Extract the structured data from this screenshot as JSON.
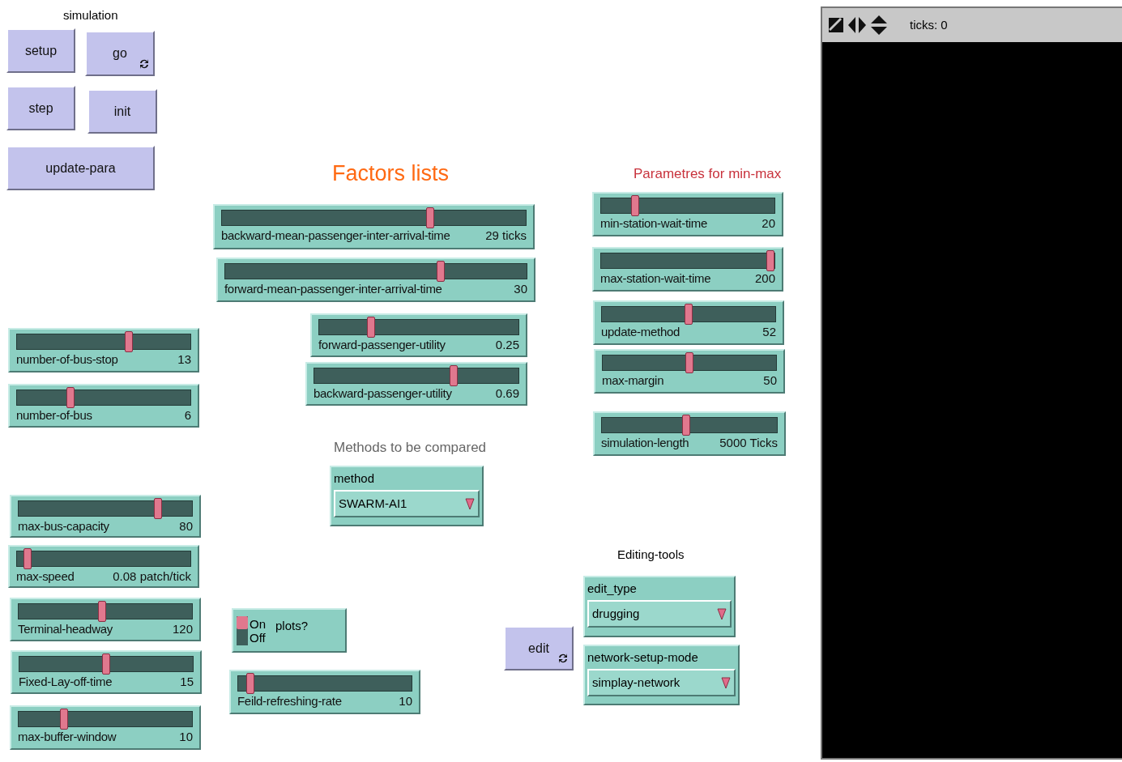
{
  "labels": [
    {
      "text": "simulation",
      "kind": "plain"
    },
    {
      "text": "Factors lists",
      "kind": "title"
    },
    {
      "text": "Parametres for min-max",
      "kind": "heading"
    },
    {
      "text": "Methods to be compared",
      "kind": "note"
    },
    {
      "text": "Editing-tools",
      "kind": "plain"
    }
  ],
  "buttons": [
    {
      "label": "setup",
      "forever": false
    },
    {
      "label": "go",
      "forever": true
    },
    {
      "label": "step",
      "forever": false
    },
    {
      "label": "init",
      "forever": false
    },
    {
      "label": "update-para",
      "forever": false
    },
    {
      "label": "edit",
      "forever": true
    }
  ],
  "sliders": [
    {
      "name": "backward-mean-passenger-inter-arrival-time",
      "reading": "29 ticks",
      "level": 0.69
    },
    {
      "name": "forward-mean-passenger-inter-arrival-time",
      "reading": "30",
      "level": 0.72
    },
    {
      "name": "forward-passenger-utility",
      "reading": "0.25",
      "level": 0.25
    },
    {
      "name": "backward-passenger-utility",
      "reading": "0.69",
      "level": 0.69
    },
    {
      "name": "number-of-bus-stop",
      "reading": "13",
      "level": 0.65
    },
    {
      "name": "number-of-bus",
      "reading": "6",
      "level": 0.3
    },
    {
      "name": "max-bus-capacity",
      "reading": "80",
      "level": 0.82
    },
    {
      "name": "max-speed",
      "reading": "0.08 patch/tick",
      "level": 0.04
    },
    {
      "name": "Terminal-headway",
      "reading": "120",
      "level": 0.48
    },
    {
      "name": "Fixed-Lay-off-time",
      "reading": "15",
      "level": 0.5
    },
    {
      "name": "max-buffer-window",
      "reading": "10",
      "level": 0.25
    },
    {
      "name": "Feild-refreshing-rate",
      "reading": "10",
      "level": 0.05
    },
    {
      "name": "min-station-wait-time",
      "reading": "20",
      "level": 0.18
    },
    {
      "name": "max-station-wait-time",
      "reading": "200",
      "level": 1
    },
    {
      "name": "update-method",
      "reading": "52",
      "level": 0.5
    },
    {
      "name": "max-margin",
      "reading": "50",
      "level": 0.5
    },
    {
      "name": "simulation-length",
      "reading": "5000 Ticks",
      "level": 0.48
    }
  ],
  "choosers": [
    {
      "name": "method",
      "value": "SWARM-AI1"
    },
    {
      "name": "edit_type",
      "value": "drugging"
    },
    {
      "name": "network-setup-mode",
      "value": "simplay-network"
    }
  ],
  "switch": {
    "label": "plots?",
    "on_text": "On",
    "off_text": "Off",
    "on": true
  },
  "view": {
    "ticks": "ticks: 0"
  }
}
